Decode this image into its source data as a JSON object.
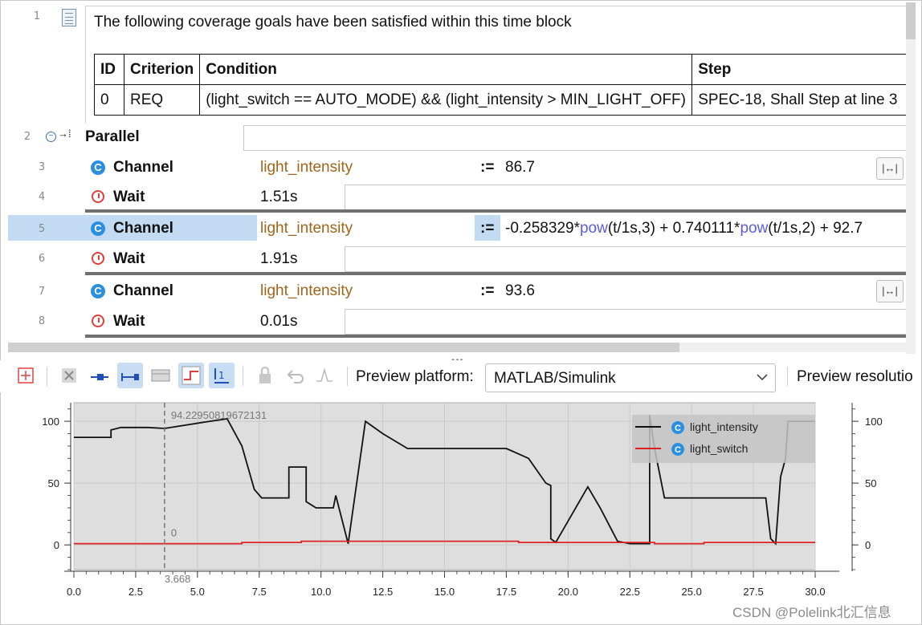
{
  "description": {
    "line_number": "1",
    "text": "The following coverage goals have been satisfied within this time block",
    "table": {
      "headers": [
        "ID",
        "Criterion",
        "Condition",
        "Step"
      ],
      "rows": [
        [
          "0",
          "REQ",
          "(light_switch == AUTO_MODE) && (light_intensity > MIN_LIGHT_OFF)",
          "SPEC-18, Shall Step at line 3"
        ]
      ]
    }
  },
  "rows": [
    {
      "num": "2",
      "keyword": "Parallel"
    },
    {
      "num": "3",
      "keyword": "Channel",
      "variable": "light_intensity",
      "op": ":=",
      "value": "86.7"
    },
    {
      "num": "4",
      "keyword": "Wait",
      "value": "1.51s"
    },
    {
      "num": "5",
      "keyword": "Channel",
      "variable": "light_intensity",
      "op": ":=",
      "expr_a": "-0.258329*",
      "fn1": "pow",
      "expr_b": "(t/1s,3) + 0.740111*",
      "fn2": "pow",
      "expr_c": "(t/1s,2) + 92.7"
    },
    {
      "num": "6",
      "keyword": "Wait",
      "value": "1.91s"
    },
    {
      "num": "7",
      "keyword": "Channel",
      "variable": "light_intensity",
      "op": ":=",
      "value": "93.6"
    },
    {
      "num": "8",
      "keyword": "Wait",
      "value": "0.01s"
    }
  ],
  "toolbar": {
    "preview_platform_label": "Preview platform:",
    "platform_value": "MATLAB/Simulink",
    "preview_resolution_label": "Preview resolutio"
  },
  "colors": {
    "keyword_var": "#a0651a",
    "accent": "#2b8fe0",
    "highlight": "#c3dbf2",
    "series_intensity": "#111111",
    "series_switch": "#e02020"
  },
  "chart_data": {
    "type": "line",
    "x_ticks": [
      "0.0",
      "2.5",
      "5.0",
      "7.5",
      "10.0",
      "12.5",
      "15.0",
      "17.5",
      "20.0",
      "22.5",
      "25.0",
      "27.5",
      "30.0"
    ],
    "y_ticks": [
      "0",
      "50",
      "100"
    ],
    "xlim": [
      0,
      30
    ],
    "ylim": [
      -20,
      115
    ],
    "cursor_x": "3.668",
    "cursor_value_top": "94.22950819672131",
    "cursor_value_bottom": "0",
    "legend": [
      "light_intensity",
      "light_switch"
    ],
    "legend_position": "top-right",
    "grid": true,
    "series": [
      {
        "name": "light_intensity",
        "points": [
          [
            0,
            87
          ],
          [
            1.5,
            87
          ],
          [
            1.5,
            93
          ],
          [
            1.9,
            95
          ],
          [
            3.0,
            95
          ],
          [
            3.668,
            94.2
          ],
          [
            5.5,
            100
          ],
          [
            6.2,
            102
          ],
          [
            6.8,
            80
          ],
          [
            7.3,
            45
          ],
          [
            7.6,
            38
          ],
          [
            8.7,
            38
          ],
          [
            8.7,
            63
          ],
          [
            9.4,
            63
          ],
          [
            9.4,
            35
          ],
          [
            9.8,
            30
          ],
          [
            10.5,
            30
          ],
          [
            10.6,
            40
          ],
          [
            11.1,
            1
          ],
          [
            11.8,
            100
          ],
          [
            12.5,
            90
          ],
          [
            13.5,
            78
          ],
          [
            17.5,
            78
          ],
          [
            18.4,
            70
          ],
          [
            19.1,
            50
          ],
          [
            19.3,
            48
          ],
          [
            19.3,
            5
          ],
          [
            19.5,
            2
          ],
          [
            20.8,
            47
          ],
          [
            21.3,
            30
          ],
          [
            22.0,
            3
          ],
          [
            22.5,
            1
          ],
          [
            23.3,
            1
          ],
          [
            23.3,
            105
          ],
          [
            23.5,
            78
          ],
          [
            23.9,
            38
          ],
          [
            28.0,
            38
          ],
          [
            28.2,
            5
          ],
          [
            28.4,
            1
          ],
          [
            28.6,
            55
          ],
          [
            28.8,
            70
          ],
          [
            28.9,
            100
          ],
          [
            30,
            100
          ]
        ]
      },
      {
        "name": "light_switch",
        "points": [
          [
            0,
            1
          ],
          [
            6.8,
            1
          ],
          [
            6.8,
            2
          ],
          [
            9.2,
            2
          ],
          [
            9.2,
            3
          ],
          [
            18.0,
            3
          ],
          [
            18.0,
            2
          ],
          [
            23.5,
            2
          ],
          [
            23.5,
            1
          ],
          [
            25.5,
            1
          ],
          [
            25.5,
            2
          ],
          [
            30,
            2
          ]
        ]
      }
    ]
  },
  "watermark": "CSDN @Polelink北汇信息"
}
